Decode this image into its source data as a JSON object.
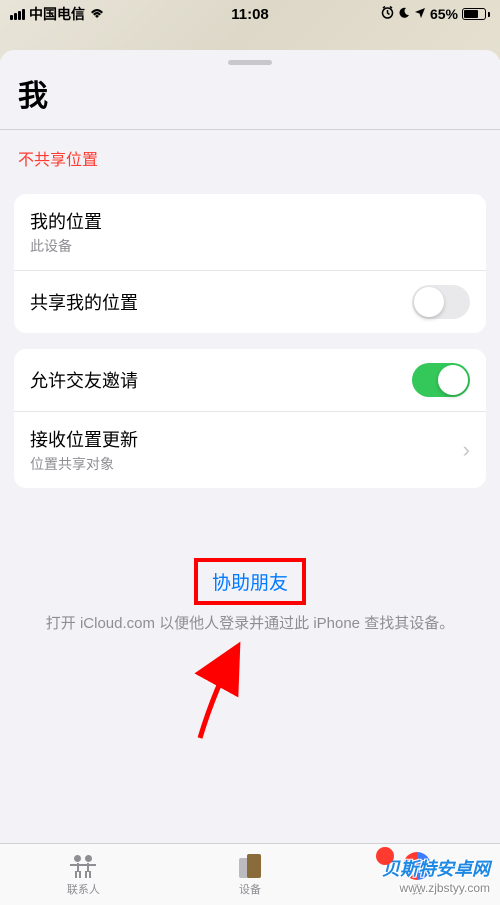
{
  "status": {
    "carrier": "中国电信",
    "time": "11:08",
    "battery_pct": "65%"
  },
  "sheet": {
    "title": "我",
    "warning": "不共享位置"
  },
  "group1": {
    "my_location_label": "我的位置",
    "my_location_sub": "此设备",
    "share_my_location_label": "共享我的位置",
    "share_toggle_on": false
  },
  "group2": {
    "allow_friend_req_label": "允许交友邀请",
    "allow_toggle_on": true,
    "receive_updates_label": "接收位置更新",
    "receive_updates_sub": "位置共享对象"
  },
  "help": {
    "link": "协助朋友",
    "desc": "打开 iCloud.com 以便他人登录并通过此 iPhone 查找其设备。"
  },
  "tabs": {
    "people": "联系人",
    "devices": "设备",
    "me": "我"
  },
  "watermark": {
    "name": "贝斯特安卓网",
    "url": "www.zjbstyy.com"
  }
}
